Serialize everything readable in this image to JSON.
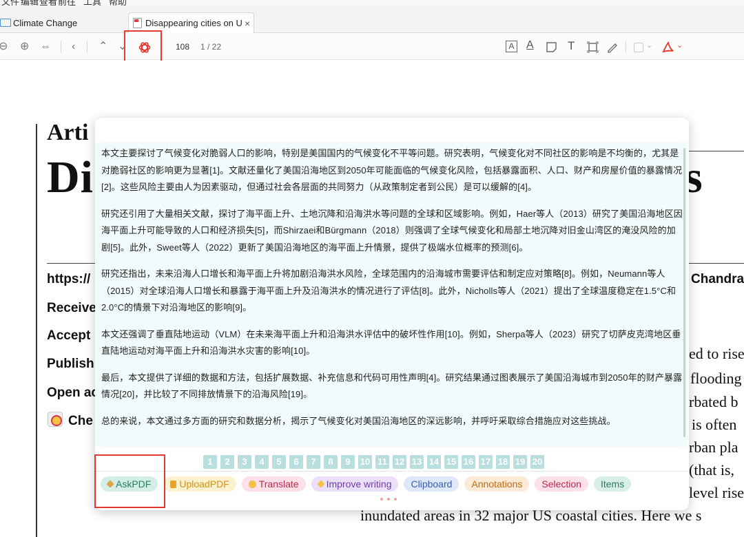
{
  "menu": [
    "文件",
    "编辑",
    "查看",
    "前往",
    "工具",
    "帮助"
  ],
  "tabs": {
    "library_label": "Climate Change",
    "doc_label": "Disappearing cities on U",
    "doc_close": "×"
  },
  "toolbar": {
    "page_current": "108",
    "page_total": "1 / 22",
    "icons": [
      "zoom-out-icon",
      "zoom-in-icon",
      "fit-width-icon",
      "back-icon",
      "prev-page-icon",
      "next-page-icon",
      "chatgpt-icon",
      "text-box-icon",
      "underline-icon",
      "note-icon",
      "text-icon",
      "area-select-icon",
      "draw-icon",
      "color-picker-icon",
      "acrobat-icon"
    ],
    "text_tools": [
      "A",
      "A",
      "T"
    ],
    "nav_glyphs": [
      "⊖",
      "⊕",
      "⇔",
      "‹",
      "⌃",
      "⌄",
      "⌄"
    ]
  },
  "document": {
    "article_label": "Arti",
    "title_fragment": "Di",
    "title_end": "s",
    "meta": [
      "https://",
      "Receive",
      "Accept",
      "Publish",
      "Open ac",
      "Che"
    ],
    "author_fragment": "Chandra",
    "body_lines": [
      "ed to rise",
      "flooding",
      "rbated b",
      "is often",
      "rban pla",
      "(that is,",
      "level rise",
      "inundated areas in 32 major US coastal cities. Here we s"
    ]
  },
  "popup": {
    "input_placeholder": "",
    "answer_paragraphs": [
      "本文主要探讨了气候变化对脆弱人口的影响，特别是美国国内的气候变化不平等问题。研究表明，气候变化对不同社区的影响是不均衡的，尤其是对脆弱社区的影响更为显著[1]。文献还量化了美国沿海地区到2050年可能面临的气候变化风险，包括暴露面积、人口、财产和房屋价值的暴露情况[2]。这些风险主要由人为因素驱动，但通过社会各层面的共同努力（从政策制定者到公民）是可以缓解的[4]。",
      "研究还引用了大量相关文献，探讨了海平面上升、土地沉降和沿海洪水等问题的全球和区域影响。例如，Haer等人（2013）研究了美国沿海地区因海平面上升可能导致的人口和经济损失[5]，而Shirzaei和Bürgmann（2018）则强调了全球气候变化和局部土地沉降对旧金山湾区的淹没风险的加剧[5]。此外，Sweet等人（2022）更新了美国沿海地区的海平面上升情景，提供了极端水位概率的预测[6]。",
      "研究还指出，未来沿海人口增长和海平面上升将加剧沿海洪水风险，全球范围内的沿海城市需要评估和制定应对策略[8]。例如，Neumann等人（2015）对全球沿海人口增长和暴露于海平面上升及沿海洪水的情况进行了评估[8]。此外，Nicholls等人（2021）提出了全球温度稳定在1.5°C和2.0°C的情景下对沿海地区的影响[9]。",
      "本文还强调了垂直陆地运动（VLM）在未来海平面上升和沿海洪水评估中的破坏性作用[10]。例如，Sherpa等人（2023）研究了切萨皮克湾地区垂直陆地运动对海平面上升和沿海洪水灾害的影响[10]。",
      "最后，本文提供了详细的数据和方法，包括扩展数据、补充信息和代码可用性声明[4]。研究结果通过图表展示了美国沿海城市到2050年的财产暴露情况[20]，并比较了不同排放情景下的沿海风险[19]。",
      "总的来说，本文通过多方面的研究和数据分析，揭示了气候变化对美国沿海地区的深远影响，并呼吁采取综合措施应对这些挑战。"
    ],
    "pages": [
      "1",
      "2",
      "3",
      "4",
      "5",
      "6",
      "7",
      "8",
      "9",
      "10",
      "11",
      "12",
      "13",
      "14",
      "15",
      "16",
      "17",
      "18",
      "19",
      "20"
    ],
    "chips": {
      "ask": "AskPDF",
      "upload": "UploadPDF",
      "translate": "Translate",
      "improve": "Improve writing",
      "clipboard": "Clipboard",
      "annotations": "Annotations",
      "selection": "Selection",
      "items": "Items"
    }
  },
  "colors": {
    "highlight": "#e5382f",
    "answer_bg": "#f2fbfb",
    "pager_bg": "#b8dede"
  }
}
